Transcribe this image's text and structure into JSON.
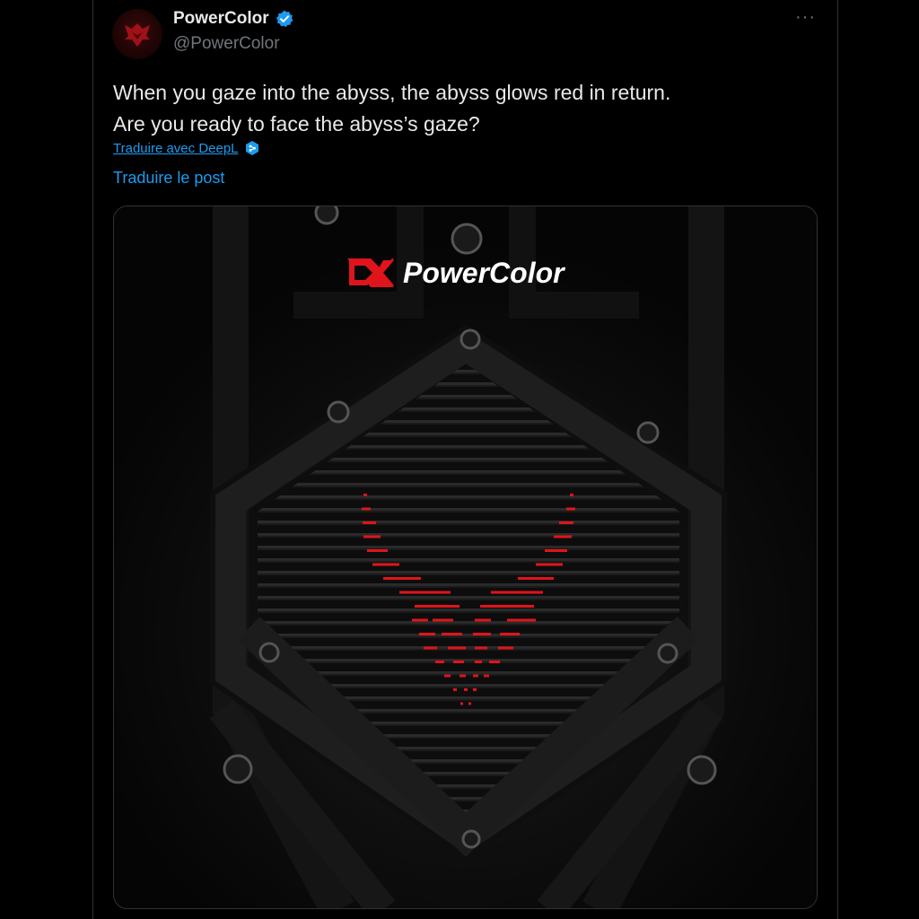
{
  "post": {
    "display_name": "PowerColor",
    "handle": "@PowerColor",
    "verified_icon": "verified-badge-icon",
    "more_label": "···",
    "text_lines": [
      "When you gaze into the abyss, the abyss glows red in return.",
      "Are you ready to face the abyss’s gaze?"
    ],
    "deepl_link": "Traduire avec DeepL",
    "translate_link": "Traduire le post"
  },
  "media": {
    "logo_text": "PowerColor",
    "description_icon": "red-devil-v-glow-icon"
  },
  "colors": {
    "background": "#000000",
    "text": "#e7e9ea",
    "muted": "#71767b",
    "link": "#1d9bf0",
    "accent_red": "#e0141b"
  }
}
